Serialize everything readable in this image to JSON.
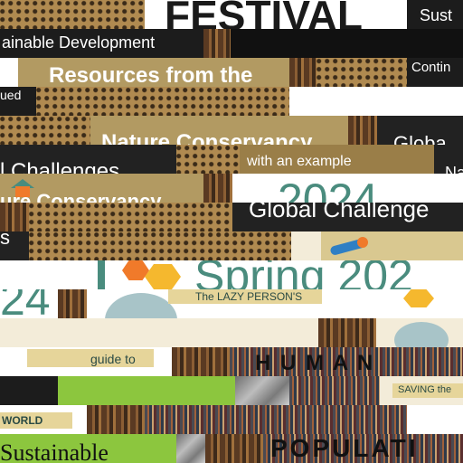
{
  "fragments": {
    "festival": "FESTIVAL",
    "sust": "Sust",
    "sustainable_development": "ainable Development",
    "contin": "Contin",
    "ued": "ued",
    "resources_from_the": "Resources from the",
    "nature_conservancy": "Nature Conservancy",
    "globa": "Globa",
    "l_challenges": "l Challenges",
    "with_an_example": "with an example",
    "na": "Na",
    "ure_conservancy": "ure Conservancy",
    "year_2024": "2024",
    "global_challenge": "Global Challenge",
    "s": "s",
    "spring_2024": "Spring 202",
    "lazy_person": "The LAZY PERSON'S",
    "num_24": "24",
    "guide_to": "guide to",
    "human": "H U M A N",
    "saving_the": "SAVING the",
    "world": "WORLD",
    "sustainable": "Sustainable",
    "population": "POPULATI"
  },
  "colors": {
    "teal": "#4a8c7e",
    "orange": "#f07a2a",
    "cream": "#f3ecd9",
    "gold": "#d9c890"
  }
}
